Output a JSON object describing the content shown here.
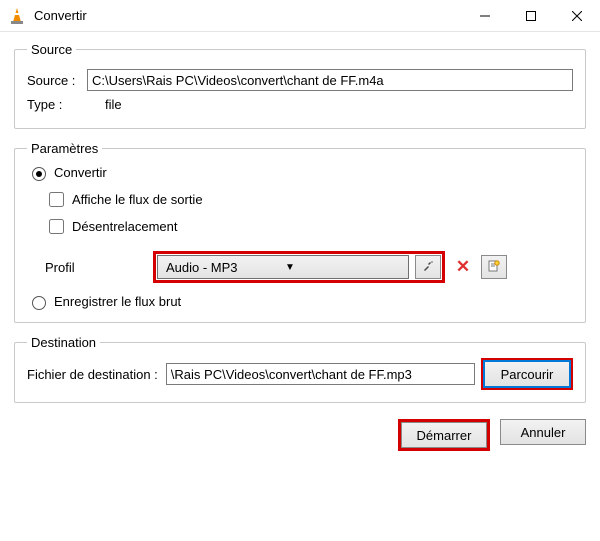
{
  "window": {
    "title": "Convertir"
  },
  "source": {
    "legend": "Source",
    "source_label": "Source :",
    "source_value": "C:\\Users\\Rais PC\\Videos\\convert\\chant de FF.m4a",
    "type_label": "Type :",
    "type_value": "file"
  },
  "params": {
    "legend": "Paramètres",
    "convert_label": "Convertir",
    "display_output_label": "Affiche le flux de sortie",
    "deinterlace_label": "Désentrelacement",
    "profil_label": "Profil",
    "profil_value": "Audio - MP3",
    "dump_raw_label": "Enregistrer le flux brut"
  },
  "dest": {
    "legend": "Destination",
    "file_label": "Fichier de destination :",
    "file_value": "\\Rais PC\\Videos\\convert\\chant de FF.mp3",
    "browse_label": "Parcourir"
  },
  "footer": {
    "start_label": "Démarrer",
    "cancel_label": "Annuler"
  }
}
